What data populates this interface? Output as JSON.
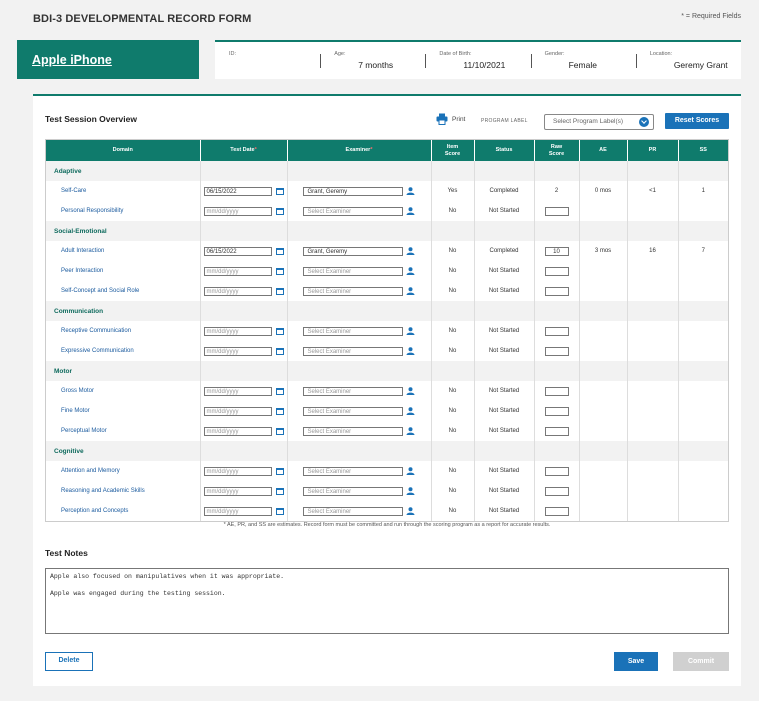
{
  "header": {
    "form_title": "BDI-3 DEVELOPMENTAL RECORD FORM",
    "required_note": "* = Required Fields"
  },
  "patient": {
    "name": "Apple iPhone",
    "fields": [
      {
        "label": "ID:",
        "value": ""
      },
      {
        "label": "Age:",
        "value": "7 months"
      },
      {
        "label": "Date of Birth:",
        "value": "11/10/2021"
      },
      {
        "label": "Gender:",
        "value": "Female"
      },
      {
        "label": "Location:",
        "value": "Geremy Grant"
      }
    ]
  },
  "session": {
    "title": "Test Session Overview",
    "print_label": "Print",
    "program_label": "PROGRAM LABEL",
    "program_placeholder": "Select Program Label(s)",
    "reset_label": "Reset Scores"
  },
  "table": {
    "headers": {
      "domain": "Domain",
      "test_date": "Test Date",
      "examiner": "Examiner",
      "item_score_1": "Item",
      "item_score_2": "Score",
      "status": "Status",
      "raw_score_1": "Raw",
      "raw_score_2": "Score",
      "ae": "AE",
      "pr": "PR",
      "ss": "SS",
      "required_mark": "*"
    },
    "date_placeholder": "mm/dd/yyyy",
    "examiner_placeholder": "Select Examiner",
    "categories": [
      {
        "name": "Adaptive",
        "rows": [
          {
            "domain": "Self-Care",
            "date": "06/15/2022",
            "examiner": "Grant, Geremy",
            "item_score": "Yes",
            "status": "Completed",
            "raw": "2",
            "raw_boxed": false,
            "ae": "0 mos",
            "pr": "<1",
            "ss": "1"
          },
          {
            "domain": "Personal Responsibility",
            "date": "",
            "examiner": "",
            "item_score": "No",
            "status": "Not Started",
            "raw": "",
            "raw_boxed": true,
            "ae": "",
            "pr": "",
            "ss": ""
          }
        ]
      },
      {
        "name": "Social-Emotional",
        "rows": [
          {
            "domain": "Adult Interaction",
            "date": "06/15/2022",
            "examiner": "Grant, Geremy",
            "item_score": "No",
            "status": "Completed",
            "raw": "10",
            "raw_boxed": true,
            "ae": "3 mos",
            "pr": "16",
            "ss": "7"
          },
          {
            "domain": "Peer Interaction",
            "date": "",
            "examiner": "",
            "item_score": "No",
            "status": "Not Started",
            "raw": "",
            "raw_boxed": true,
            "ae": "",
            "pr": "",
            "ss": ""
          },
          {
            "domain": "Self-Concept and Social Role",
            "date": "",
            "examiner": "",
            "item_score": "No",
            "status": "Not Started",
            "raw": "",
            "raw_boxed": true,
            "ae": "",
            "pr": "",
            "ss": ""
          }
        ]
      },
      {
        "name": "Communication",
        "rows": [
          {
            "domain": "Receptive Communication",
            "date": "",
            "examiner": "",
            "item_score": "No",
            "status": "Not Started",
            "raw": "",
            "raw_boxed": true,
            "ae": "",
            "pr": "",
            "ss": ""
          },
          {
            "domain": "Expressive Communication",
            "date": "",
            "examiner": "",
            "item_score": "No",
            "status": "Not Started",
            "raw": "",
            "raw_boxed": true,
            "ae": "",
            "pr": "",
            "ss": ""
          }
        ]
      },
      {
        "name": "Motor",
        "rows": [
          {
            "domain": "Gross Motor",
            "date": "",
            "examiner": "",
            "item_score": "No",
            "status": "Not Started",
            "raw": "",
            "raw_boxed": true,
            "ae": "",
            "pr": "",
            "ss": ""
          },
          {
            "domain": "Fine Motor",
            "date": "",
            "examiner": "",
            "item_score": "No",
            "status": "Not Started",
            "raw": "",
            "raw_boxed": true,
            "ae": "",
            "pr": "",
            "ss": ""
          },
          {
            "domain": "Perceptual Motor",
            "date": "",
            "examiner": "",
            "item_score": "No",
            "status": "Not Started",
            "raw": "",
            "raw_boxed": true,
            "ae": "",
            "pr": "",
            "ss": ""
          }
        ]
      },
      {
        "name": "Cognitive",
        "rows": [
          {
            "domain": "Attention and Memory",
            "date": "",
            "examiner": "",
            "item_score": "No",
            "status": "Not Started",
            "raw": "",
            "raw_boxed": true,
            "ae": "",
            "pr": "",
            "ss": ""
          },
          {
            "domain": "Reasoning and Academic Skills",
            "date": "",
            "examiner": "",
            "item_score": "No",
            "status": "Not Started",
            "raw": "",
            "raw_boxed": true,
            "ae": "",
            "pr": "",
            "ss": ""
          },
          {
            "domain": "Perception and Concepts",
            "date": "",
            "examiner": "",
            "item_score": "No",
            "status": "Not Started",
            "raw": "",
            "raw_boxed": true,
            "ae": "",
            "pr": "",
            "ss": ""
          }
        ]
      }
    ]
  },
  "estimate_note": "* AE, PR, and SS are estimates. Record form must be committed and run through the scoring program as a report for accurate results.",
  "notes": {
    "title": "Test Notes",
    "lines": [
      "Apple also focused on manipulatives when it was appropriate.",
      "Apple was engaged during the testing session."
    ]
  },
  "actions": {
    "delete_label": "Delete",
    "save_label": "Save",
    "commit_label": "Commit"
  },
  "colors": {
    "teal": "#0f7b6c",
    "blue": "#1a72b8",
    "disabled": "#d0d0d0"
  }
}
